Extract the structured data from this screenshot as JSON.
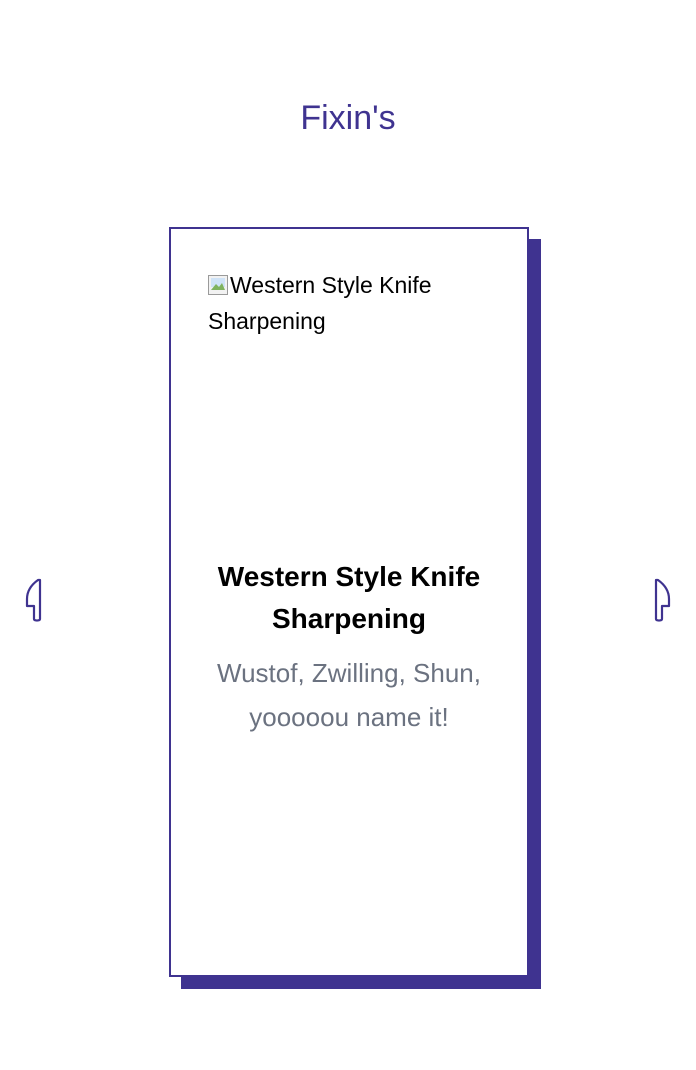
{
  "section": {
    "title": "Fixin's"
  },
  "card": {
    "image_alt": "Western Style Knife Sharpening",
    "title": "Western Style Knife Sharpening",
    "description": "Wustof, Zwilling, Shun, yooooou name it!"
  },
  "nav": {
    "prev_icon": "knife-left-icon",
    "next_icon": "knife-right-icon"
  },
  "colors": {
    "accent": "#3f3390",
    "description_text": "#6b7280"
  }
}
